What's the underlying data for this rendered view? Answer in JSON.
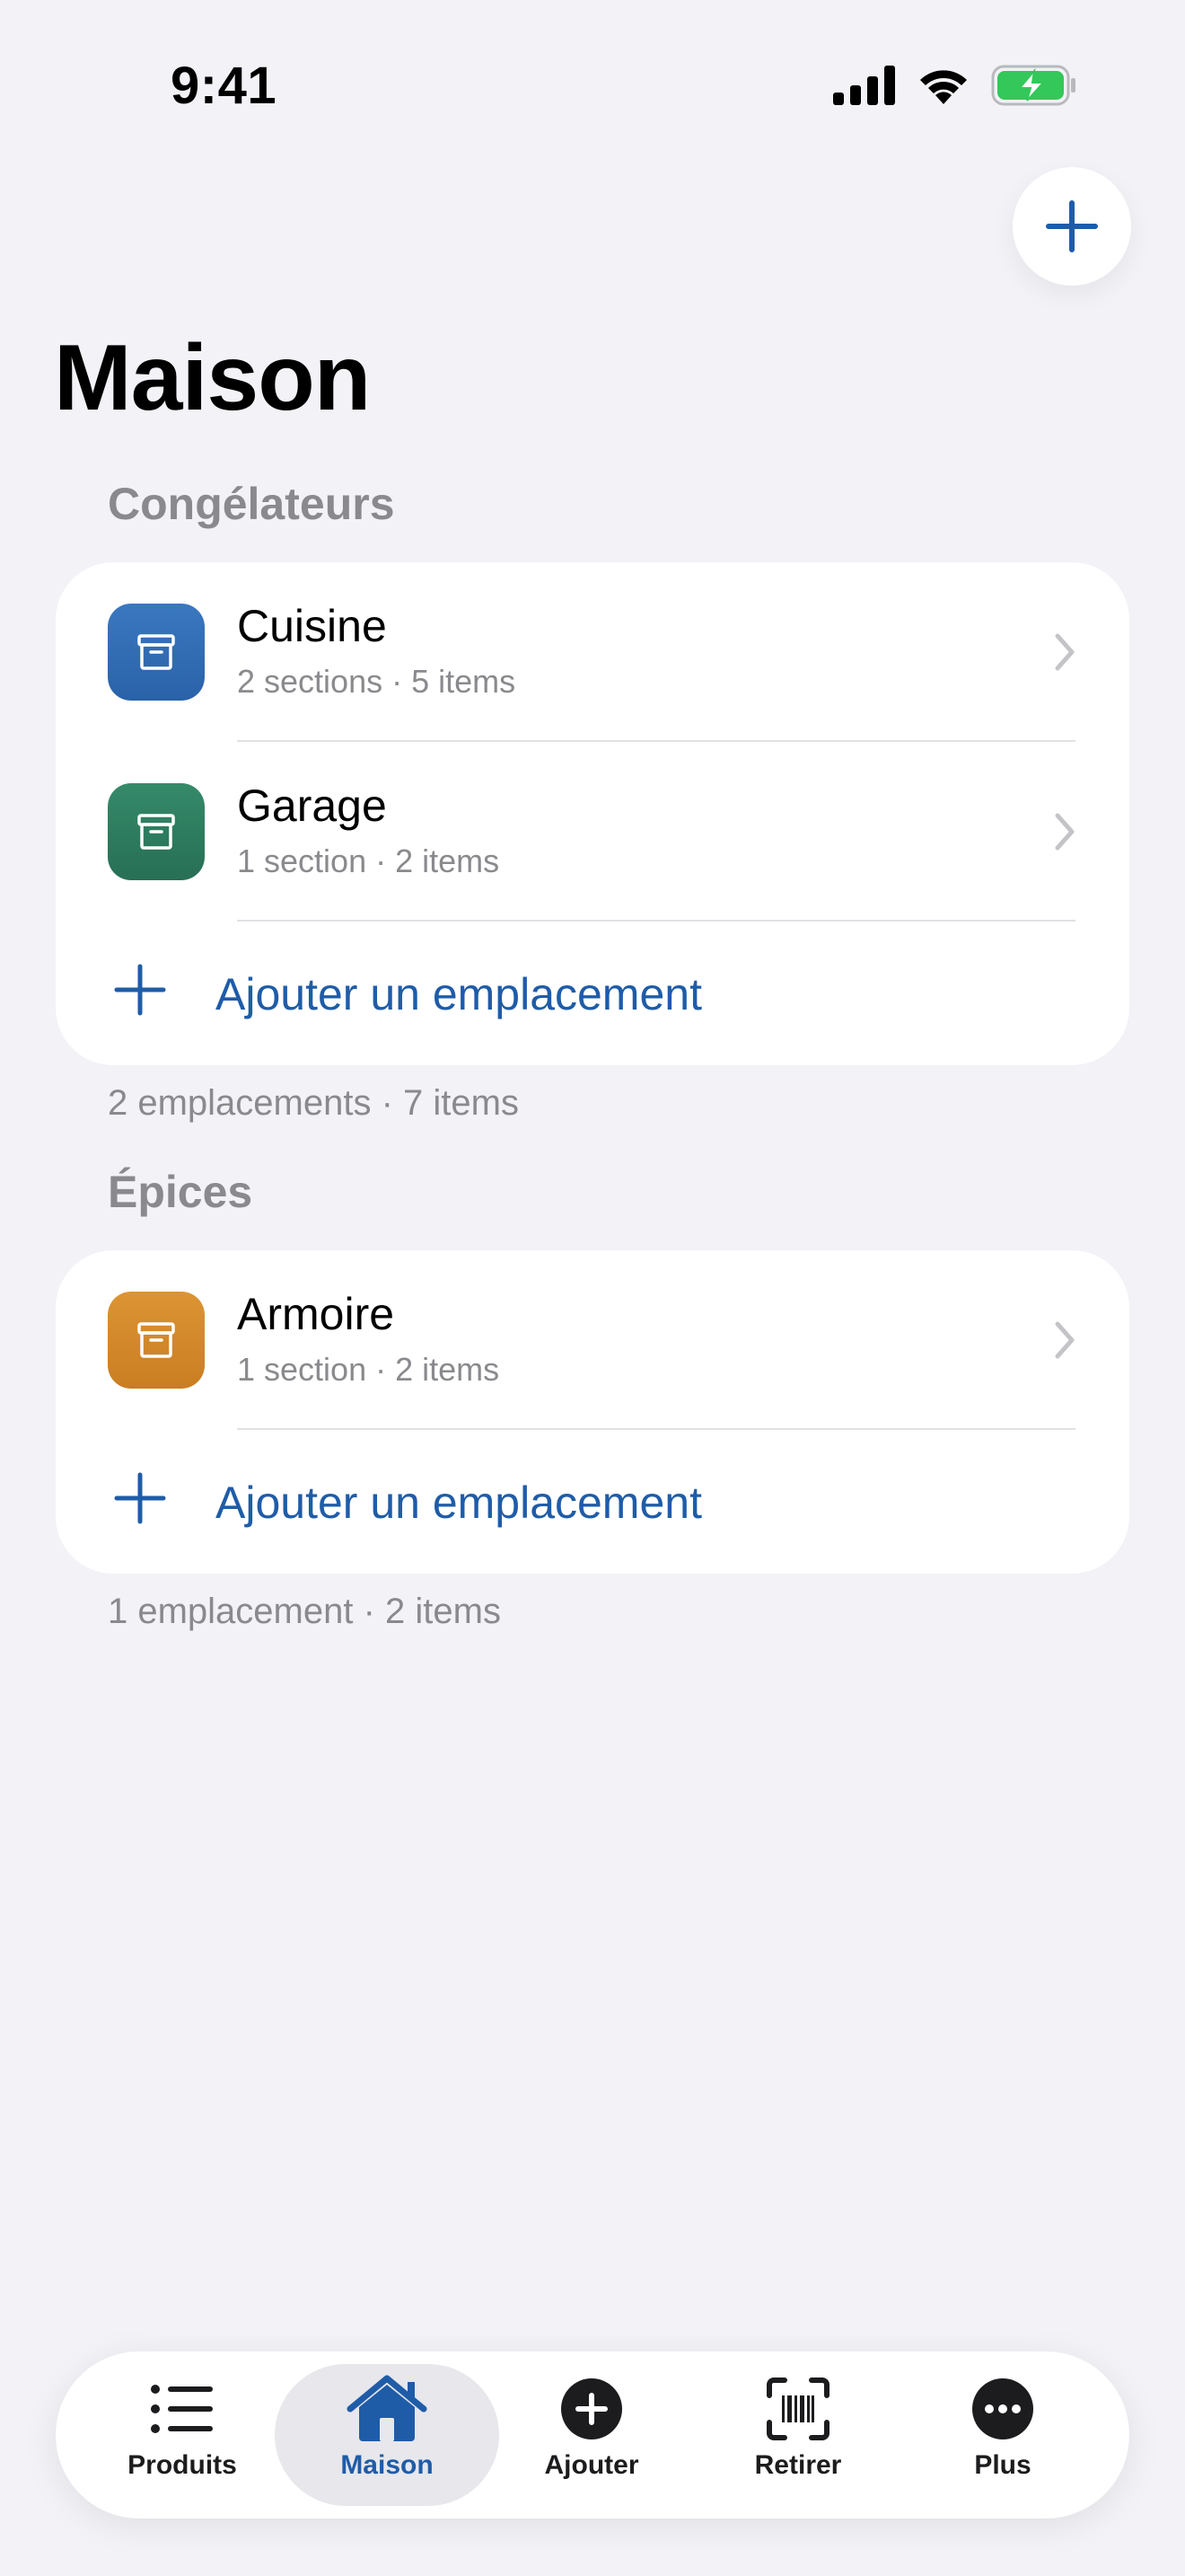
{
  "status_bar": {
    "time": "9:41"
  },
  "page": {
    "title": "Maison"
  },
  "colors": {
    "accent": "#1F5CA8",
    "blue_icon": "#2F6CB5",
    "green_icon": "#2C8062",
    "orange_icon": "#D68A2A"
  },
  "sections": [
    {
      "header": "Congélateurs",
      "items": [
        {
          "title": "Cuisine",
          "subtitle": "2 sections · 5 items",
          "icon": "archive-box-icon"
        },
        {
          "title": "Garage",
          "subtitle": "1 section · 2 items",
          "icon": "archive-box-icon"
        }
      ],
      "add_label": "Ajouter un emplacement",
      "footer": "2 emplacements · 7 items"
    },
    {
      "header": "Épices",
      "items": [
        {
          "title": "Armoire",
          "subtitle": "1 section · 2 items",
          "icon": "archive-box-icon"
        }
      ],
      "add_label": "Ajouter un emplacement",
      "footer": "1 emplacement · 2 items"
    }
  ],
  "tabs": [
    {
      "label": "Produits",
      "icon": "list-icon",
      "active": false
    },
    {
      "label": "Maison",
      "icon": "house-icon",
      "active": true
    },
    {
      "label": "Ajouter",
      "icon": "plus-circle-icon",
      "active": false
    },
    {
      "label": "Retirer",
      "icon": "barcode-scan-icon",
      "active": false
    },
    {
      "label": "Plus",
      "icon": "more-circle-icon",
      "active": false
    }
  ]
}
